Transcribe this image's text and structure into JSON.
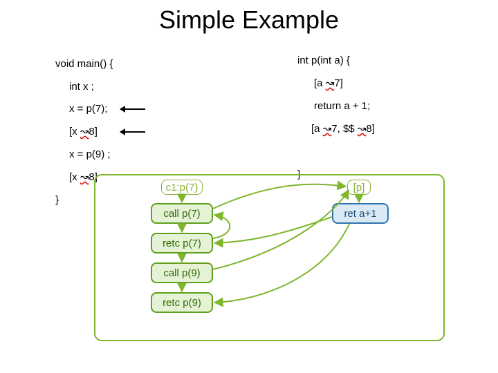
{
  "title": "Simple Example",
  "left": {
    "l1": "void main() {",
    "l2": "int x ;",
    "l3": "x = p(7);",
    "l4_open": "[x ",
    "l4_wave": "↝",
    "l4_close": "8]",
    "l5": "x = p(9) ;",
    "l6_open": "[x ",
    "l6_wave": "↝",
    "l6_close": "8]",
    "l7": "}"
  },
  "right": {
    "r1": "int p(int a) {",
    "r2_open": "[a ",
    "r2_wave": "↝",
    "r2_close": "7]",
    "r3": "return a + 1;",
    "r4_open": "[a ",
    "r4_wave": "↝",
    "r4_mid": "7, $$ ",
    "r4_wave2": "↝",
    "r4_close": "8]",
    "r5": "}"
  },
  "nodes": {
    "c1p1": "c1:p(7)",
    "callp7": "call p(7)",
    "retcp7": "retc p(7)",
    "callp9": "call p(9)",
    "retcp9": "retc p(9)",
    "ip": "[p]",
    "reta1": "ret a+1"
  }
}
